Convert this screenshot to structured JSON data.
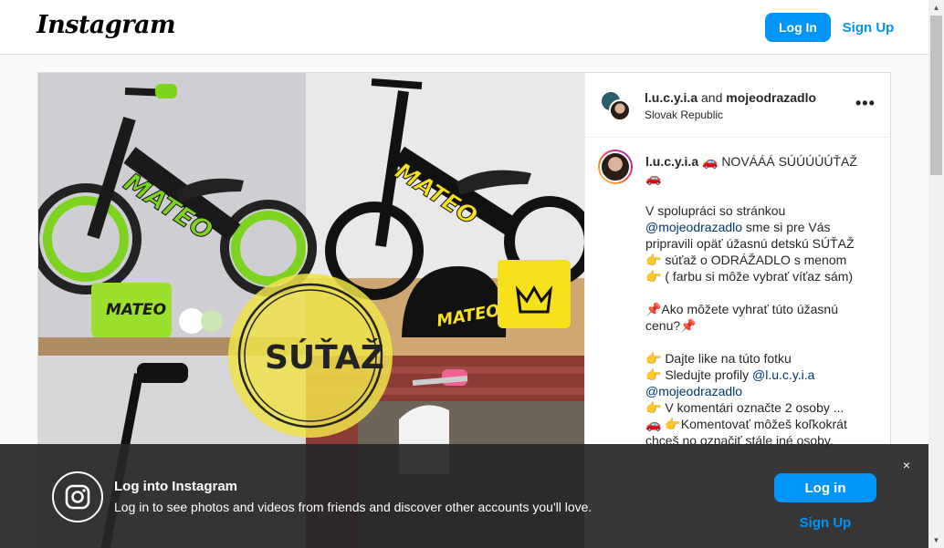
{
  "header": {
    "logo_text": "Instagram",
    "login_label": "Log In",
    "signup_label": "Sign Up"
  },
  "post": {
    "authors_primary": "l.u.c.y.i.a",
    "authors_joiner": " and ",
    "authors_secondary": "mojeodrazadlo",
    "location": "Slovak Republic",
    "more_label": "•••",
    "image": {
      "labels": [
        "MATEO",
        "MATEO",
        "MATEO",
        "MATEO"
      ],
      "badge_text": "SÚŤAŽ"
    },
    "caption": {
      "author": "l.u.c.y.i.a",
      "lines": [
        "🚗 NOVÁÁÁ SÚÚÚÚÚŤAŽ",
        "🚗",
        "",
        "V spolupráci so stránkou",
        "@mojeodrazadlo sme si pre Vás",
        "pripravili opäť úžasnú detskú SÚŤAŽ",
        "👉 súťaž o ODRÁŽADLO s menom",
        "👉 ( farbu si môže vybrať víťaz sám)",
        "",
        "📌Ako môžete vyhrať túto úžasnú",
        "cenu?📌",
        "",
        "👉 Dajte like na túto fotku",
        "👉 Sledujte profily @l.u.c.y.i.a",
        "@mojeodrazadlo",
        "👉 V komentári označte 2 osoby ...",
        "🚗 👉Komentovať môžeš koľkokrát",
        "chceš no označiť stále iné osoby."
      ]
    }
  },
  "overlay": {
    "title": "Log into Instagram",
    "text": "Log in to see photos and videos from friends and discover other accounts you'll love.",
    "login_label": "Log in",
    "signup_label": "Sign Up",
    "close_label": "×"
  },
  "scrollbar": {
    "up_label": "▲",
    "down_label": "▼"
  },
  "colors": {
    "accent": "#0095f6",
    "link": "#00376b",
    "overlay": "#262626"
  }
}
